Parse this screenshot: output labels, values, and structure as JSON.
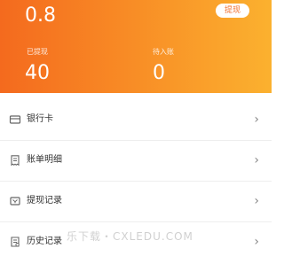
{
  "header": {
    "balance_amount": "0.8",
    "withdraw_label": "提现",
    "stats": [
      {
        "label": "已提现",
        "value": "40"
      },
      {
        "label": "待入账",
        "value": "0"
      }
    ]
  },
  "menu": {
    "items": [
      {
        "label": "银行卡",
        "icon": "bank-card-icon"
      },
      {
        "label": "账单明细",
        "icon": "bill-icon"
      },
      {
        "label": "提现记录",
        "icon": "withdraw-record-icon"
      },
      {
        "label": "历史记录",
        "icon": "history-icon"
      }
    ]
  },
  "watermark": {
    "text": "乐下载・CXLEDU.COM"
  },
  "colors": {
    "hero_start": "#f46a1e",
    "hero_end": "#fbb12f",
    "accent_text": "#f07030",
    "menu_text": "#333333"
  }
}
